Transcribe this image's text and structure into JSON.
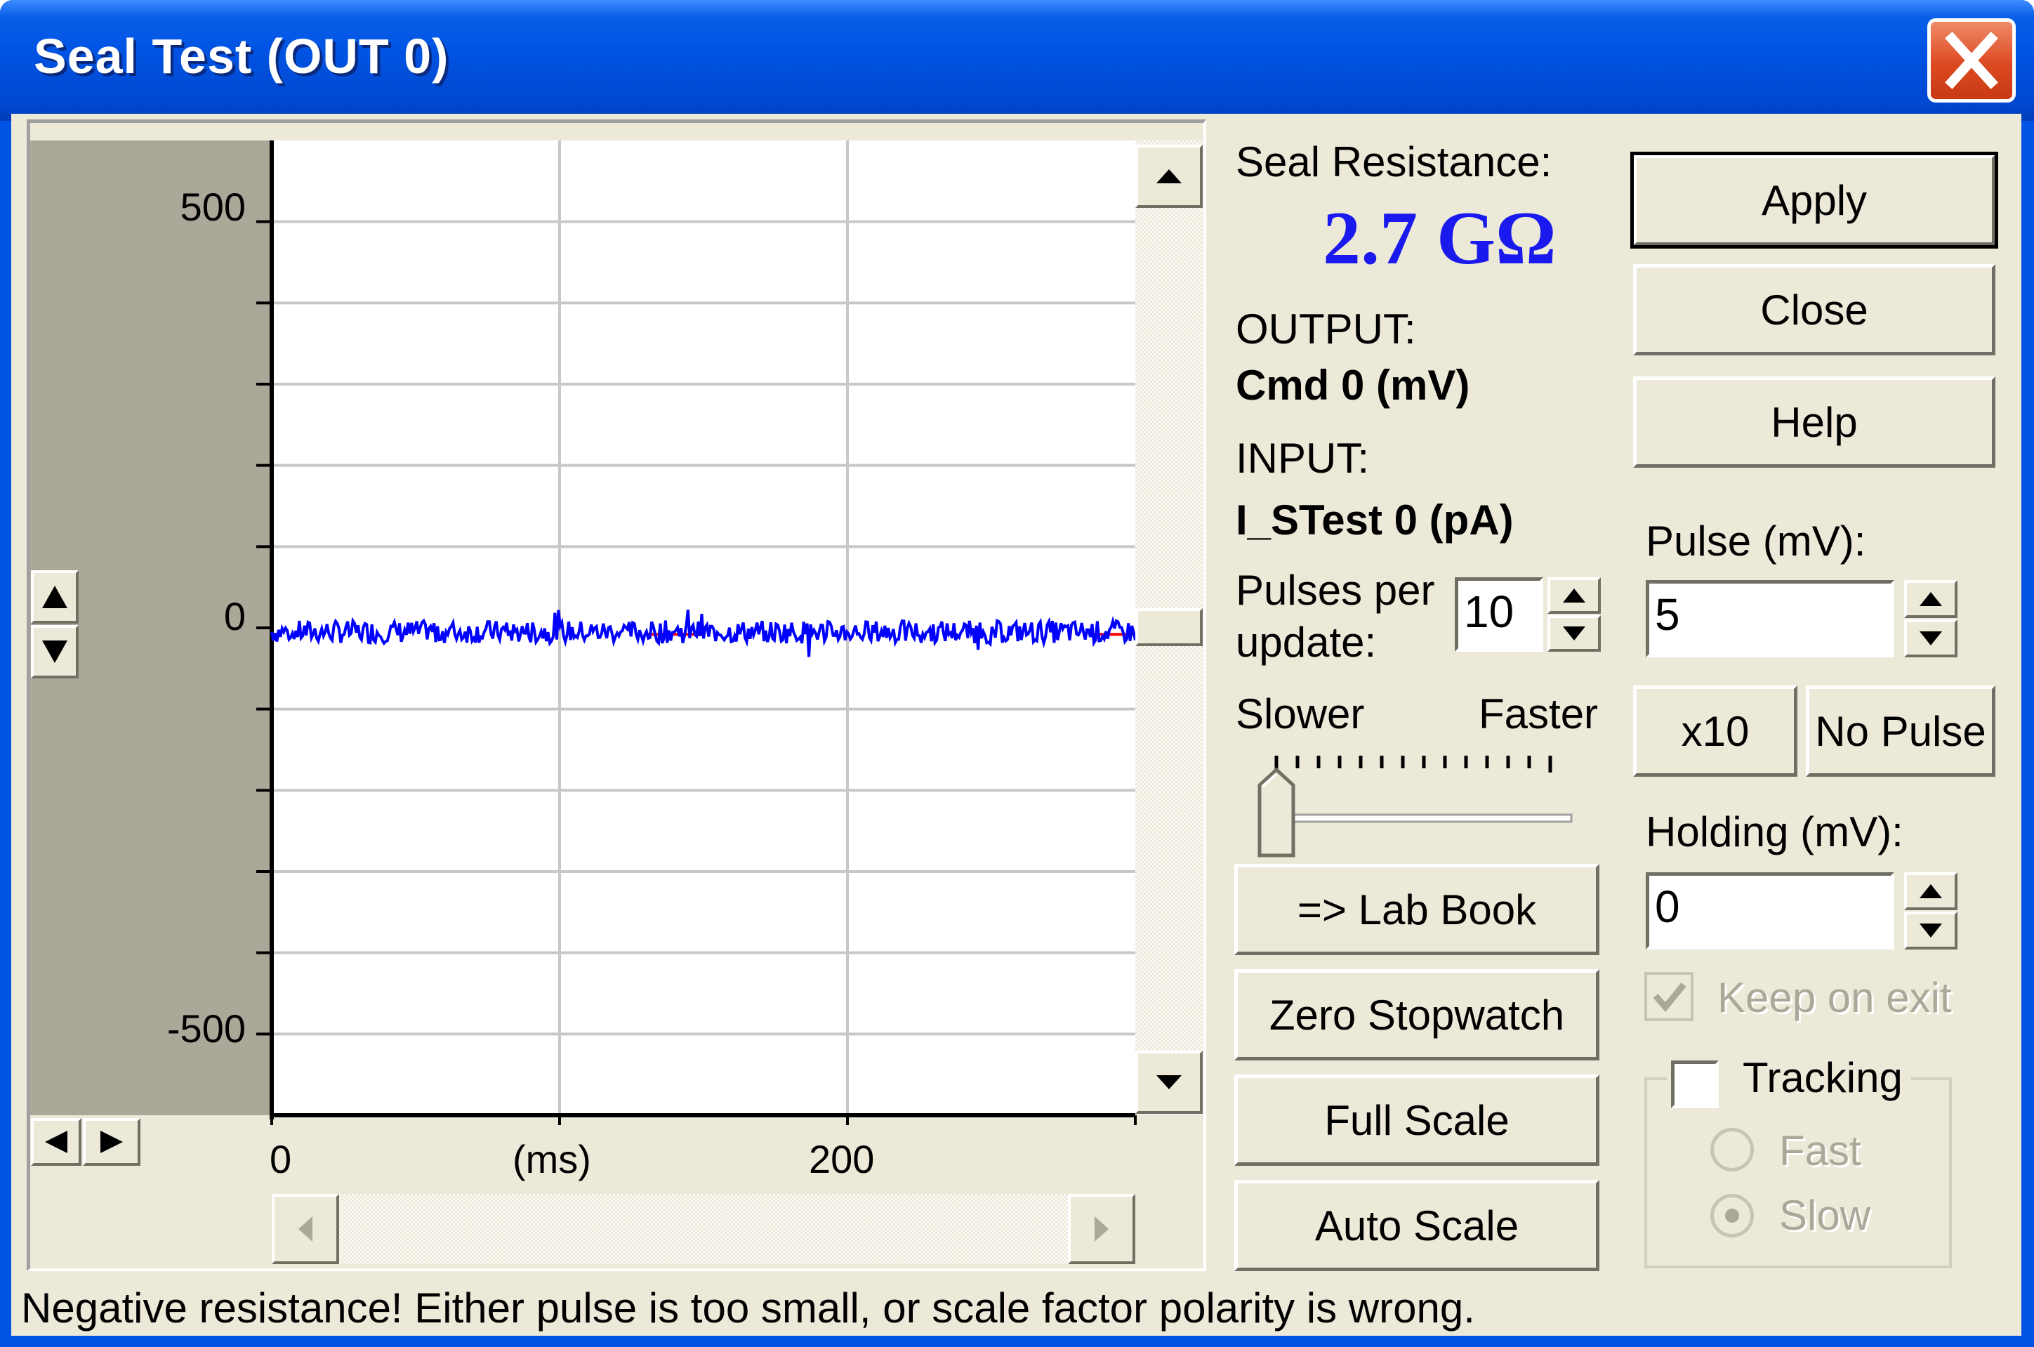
{
  "window": {
    "title": "Seal Test (OUT 0)",
    "close_icon": "close-icon"
  },
  "graph": {
    "y_ticks": [
      "500",
      "0",
      "-500"
    ],
    "x_ticks": [
      "0",
      "200"
    ],
    "x_unit": "(ms)",
    "trace_color": "#0000ff",
    "baseline_color": "#ff0000"
  },
  "chart_data": {
    "type": "line",
    "xlabel": "(ms)",
    "ylabel": "",
    "xlim": [
      0,
      300
    ],
    "ylim": [
      -600,
      600
    ],
    "yticks": [
      500,
      0,
      -500
    ],
    "xticks": [
      0,
      200
    ],
    "grid": true,
    "series": [
      {
        "color": "#0000ff",
        "x": [
          0,
          300
        ],
        "y": [
          -5,
          -5
        ]
      }
    ]
  },
  "info": {
    "seal_label": "Seal Resistance:",
    "seal_value": "2.7 GΩ",
    "seal_color": "#1a1aee",
    "output_label": "OUTPUT:",
    "output_value": "Cmd 0 (mV)",
    "input_label": "INPUT:",
    "input_value": "I_STest 0 (pA)",
    "pulses_label_1": "Pulses per",
    "pulses_label_2": "update:",
    "pulses_value": "10",
    "slower_label": "Slower",
    "faster_label": "Faster"
  },
  "buttons": {
    "lab_book": "=> Lab Book",
    "zero_stopwatch": "Zero Stopwatch",
    "full_scale": "Full Scale",
    "auto_scale": "Auto Scale",
    "apply": "Apply",
    "close": "Close",
    "help": "Help",
    "x10": "x10",
    "no_pulse": "No Pulse"
  },
  "pulse": {
    "label": "Pulse (mV):",
    "value": "5"
  },
  "holding": {
    "label": "Holding (mV):",
    "value": "0"
  },
  "keep_on_exit": {
    "label": "Keep on exit",
    "checked": true,
    "disabled": true
  },
  "tracking": {
    "label": "Tracking",
    "checked": false,
    "fast": "Fast",
    "slow": "Slow",
    "selected": "Slow"
  },
  "status": "Negative resistance! Either pulse is too small, or scale factor polarity is wrong."
}
